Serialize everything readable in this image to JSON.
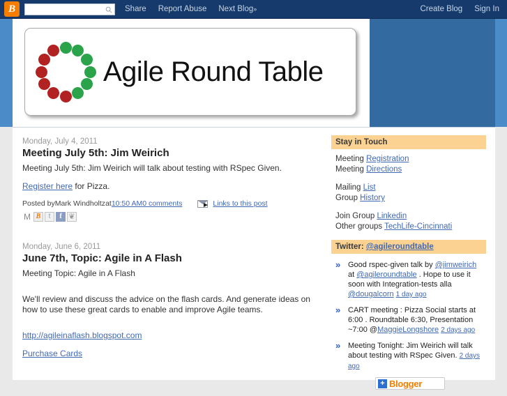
{
  "navbar": {
    "logo_letter": "B",
    "search_placeholder": "",
    "search_value": "",
    "links": [
      {
        "label": "Share"
      },
      {
        "label": "Report Abuse"
      },
      {
        "label": "Next Blog",
        "suffix": "»"
      }
    ],
    "right_links": [
      {
        "label": "Create Blog"
      },
      {
        "label": "Sign In"
      }
    ]
  },
  "header": {
    "blog_title": "Agile Round Table",
    "logo_dot_colors": {
      "green": "#2aa34a",
      "red": "#b22222"
    }
  },
  "posts": [
    {
      "date": "Monday, July 4, 2011",
      "title": "Meeting July 5th: Jim Weirich",
      "paragraphs": [
        {
          "text": "Meeting July 5th:  Jim Weirich will talk about testing with RSpec Given."
        }
      ],
      "register_link": "Register here",
      "register_tail": " for Pizza.",
      "footer": {
        "posted_by_prefix": "Posted by ",
        "author": "Mark Windholtz",
        "at": " at ",
        "time": "10:50 AM",
        "comments": "0 comments",
        "links_to_post": "Links to this post"
      },
      "share_icons": [
        {
          "name": "email-icon",
          "glyph": "M",
          "cls": "mail"
        },
        {
          "name": "blogger-icon",
          "glyph": "B",
          "cls": "blogger"
        },
        {
          "name": "twitter-icon",
          "glyph": "t",
          "cls": "twitter"
        },
        {
          "name": "facebook-icon",
          "glyph": "f",
          "cls": "facebook"
        },
        {
          "name": "share-icon",
          "glyph": "❦",
          "cls": "share"
        }
      ]
    },
    {
      "date": "Monday, June 6, 2011",
      "title": "June 7th, Topic: Agile in A Flash",
      "topic_line": "Meeting Topic: Agile in A Flash",
      "body": "We'll review and discuss the advice on the flash cards.  And generate ideas on how to use these great cards to enable and improve Agile teams.",
      "url_link": "http://agileinaflash.blogspot.com",
      "purchase_link": "Purchase Cards"
    }
  ],
  "sidebar": {
    "stay_in_touch": {
      "title": "Stay in Touch",
      "groups": [
        [
          {
            "prefix": "Meeting ",
            "link": "Registration"
          },
          {
            "prefix": "Meeting ",
            "link": "Directions"
          }
        ],
        [
          {
            "prefix": "Mailing ",
            "link": "List"
          },
          {
            "prefix": "Group ",
            "link": "History"
          }
        ],
        [
          {
            "prefix": "Join Group ",
            "link": "Linkedin"
          },
          {
            "prefix": "Other groups ",
            "link": "TechLife-Cincinnati"
          }
        ]
      ]
    },
    "twitter": {
      "title_prefix": "Twitter: ",
      "handle": "@agileroundtable",
      "tweets": [
        {
          "segments": [
            {
              "t": "Good rspec-given talk by ",
              "link": false
            },
            {
              "t": "@jimweirich",
              "link": true
            },
            {
              "t": " at ",
              "link": false
            },
            {
              "t": "@agileroundtable",
              "link": true
            },
            {
              "t": " . Hope to use it soon with Integration-tests alla ",
              "link": false
            },
            {
              "t": "@dougalcorn",
              "link": true
            },
            {
              "t": " ",
              "link": false
            }
          ],
          "ago": "1 day ago"
        },
        {
          "segments": [
            {
              "t": "CART meeting : Pizza Social starts at 6:00 . Roundtable 6:30, Presentation ~7:00 @",
              "link": false
            },
            {
              "t": "MaggieLongshore",
              "link": true
            },
            {
              "t": " ",
              "link": false
            }
          ],
          "ago": "2 days ago"
        },
        {
          "segments": [
            {
              "t": "Meeting Tonight: Jim Weirich will talk about testing with RSpec Given. ",
              "link": false
            }
          ],
          "ago": "2 days ago"
        }
      ]
    },
    "blogger_badge": {
      "plus": "+",
      "label": "Blogger"
    }
  }
}
